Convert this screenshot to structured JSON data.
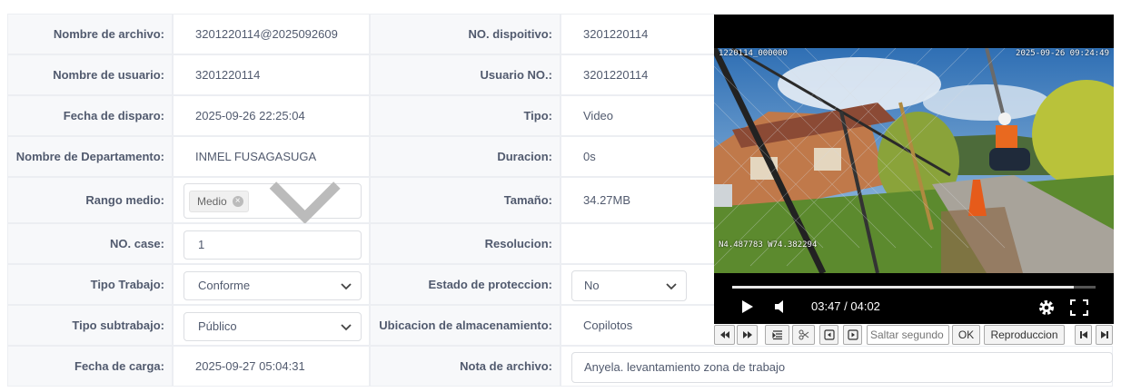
{
  "rows": [
    {
      "left_label": "Nombre de archivo:",
      "left_value": "3201220114@2025092609",
      "right_label": "NO. dispoitivo:",
      "right_value": "3201220114"
    },
    {
      "left_label": "Nombre de usuario:",
      "left_value": "3201220114",
      "right_label": "Usuario NO.:",
      "right_value": "3201220114"
    },
    {
      "left_label": "Fecha de disparo:",
      "left_value": "2025-09-26 22:25:04",
      "right_label": "Tipo:",
      "right_value": "Video"
    },
    {
      "left_label": "Nombre de Departamento:",
      "left_value": "INMEL FUSAGASUGA",
      "right_label": "Duracion:",
      "right_value": "0s"
    },
    {
      "left_label": "Rango medio:",
      "left_value": "",
      "right_label": "Tamaño:",
      "right_value": "34.27MB"
    },
    {
      "left_label": "NO. case:",
      "left_value": "1",
      "right_label": "Resolucion:",
      "right_value": ""
    },
    {
      "left_label": "Tipo Trabajo:",
      "left_value": "Conforme",
      "right_label": "Estado de proteccion:",
      "right_value": "No"
    },
    {
      "left_label": "Tipo subtrabajo:",
      "left_value": "Público",
      "right_label": "Ubicacion de almacenamiento:",
      "right_value": "Copilotos"
    },
    {
      "left_label": "Fecha de carga:",
      "left_value": "2025-09-27 05:04:31",
      "right_label": "Nota de archivo:",
      "right_value": "Anyela. levantamiento zona de trabajo"
    }
  ],
  "rango_tag": "Medio",
  "video": {
    "osd_top_left": "1220114_000000",
    "osd_top_right": "2025-09-26 09:24:49",
    "osd_gps": "N4.487783 W74.382294",
    "time": "03:47 / 04:02",
    "progress": 0.94,
    "icons": [
      "play-icon",
      "volume-icon",
      "settings-icon",
      "fullscreen-icon"
    ]
  },
  "toolbar": {
    "skip_placeholder": "Saltar segundo",
    "ok_label": "OK",
    "playback_label": "Reproduccion",
    "icons": [
      "rewind-icon",
      "fast-forward-icon",
      "list-icon",
      "scissors-icon",
      "prev-frame-icon",
      "next-frame-icon",
      "skip-start-icon",
      "skip-end-icon"
    ]
  }
}
